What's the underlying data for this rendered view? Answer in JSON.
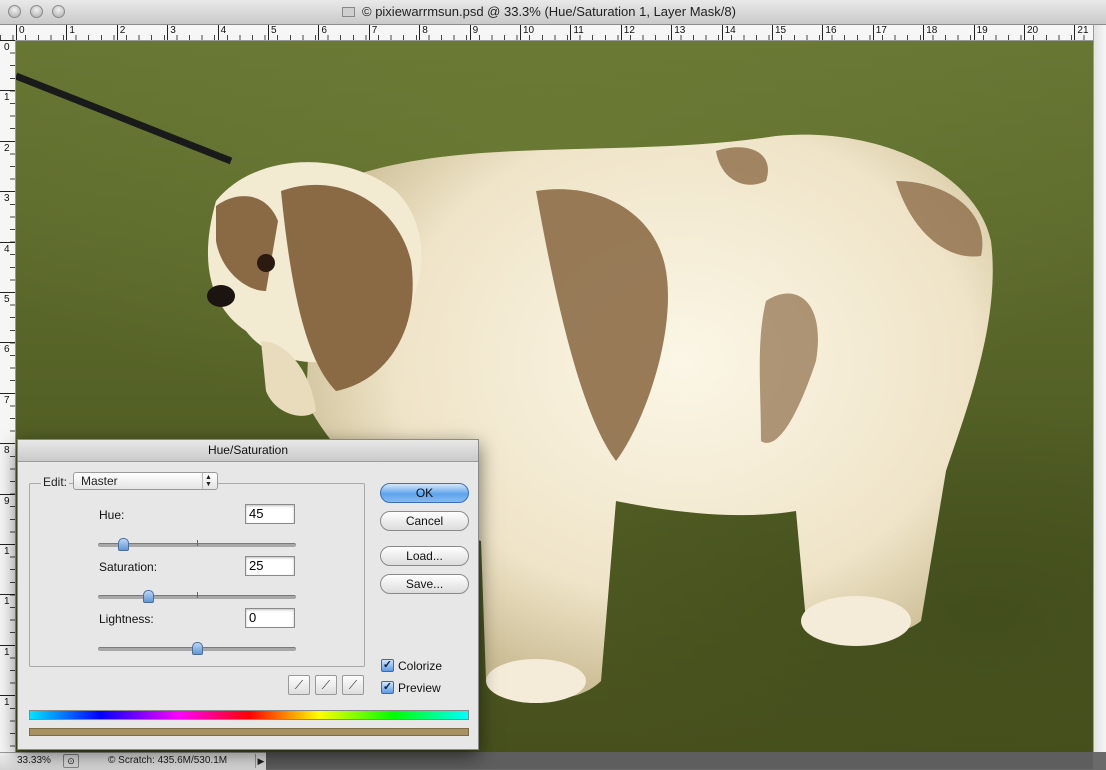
{
  "window": {
    "title": "© pixiewarrmsun.psd @ 33.3% (Hue/Saturation 1, Layer Mask/8)"
  },
  "rulers": {
    "top": [
      "0",
      "1",
      "2",
      "3",
      "4",
      "5",
      "6",
      "7",
      "8",
      "9",
      "10",
      "11",
      "12",
      "13",
      "14",
      "15",
      "16",
      "17",
      "18",
      "19",
      "20",
      "21"
    ],
    "left": [
      "0",
      "1",
      "2",
      "3",
      "4",
      "5",
      "6",
      "7",
      "8",
      "9",
      "1",
      "1",
      "1",
      "1"
    ]
  },
  "status": {
    "zoom": "33.33%",
    "scratch": "© Scratch: 435.6M/530.1M"
  },
  "dialog": {
    "title": "Hue/Saturation",
    "edit_label": "Edit:",
    "edit_value": "Master",
    "hue_label": "Hue:",
    "hue_value": "45",
    "saturation_label": "Saturation:",
    "saturation_value": "25",
    "lightness_label": "Lightness:",
    "lightness_value": "0",
    "ok": "OK",
    "cancel": "Cancel",
    "load": "Load...",
    "save": "Save...",
    "colorize_label": "Colorize",
    "preview_label": "Preview",
    "colorize_checked": true,
    "preview_checked": true,
    "hue_slider_fraction": 0.125,
    "saturation_slider_fraction": 0.25,
    "lightness_slider_fraction": 0.5,
    "colorize_color": "#a89163"
  }
}
